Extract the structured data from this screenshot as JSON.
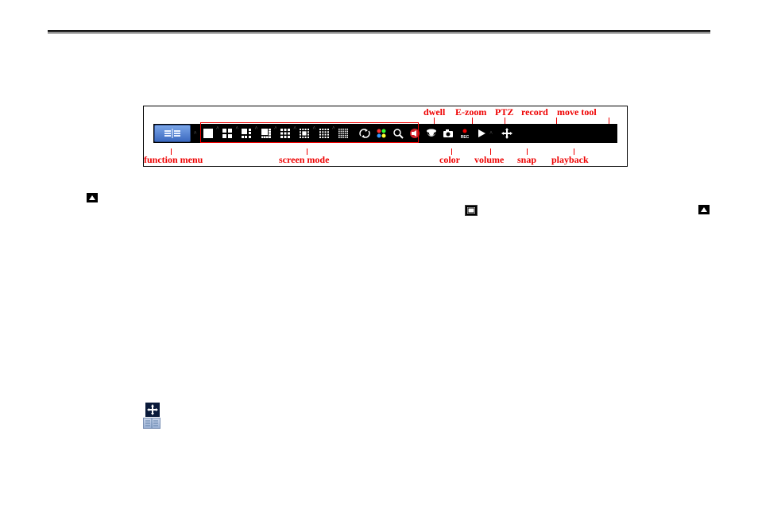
{
  "top_annotations": {
    "dwell": "dwell",
    "ezoom": "E-zoom",
    "ptz": "PTZ",
    "record": "record",
    "move_tool": "move tool"
  },
  "bottom_annotations": {
    "function_menu": "function menu",
    "screen_mode": "screen mode",
    "color": "color",
    "volume": "volume",
    "snap": "snap",
    "playback": "playback"
  }
}
